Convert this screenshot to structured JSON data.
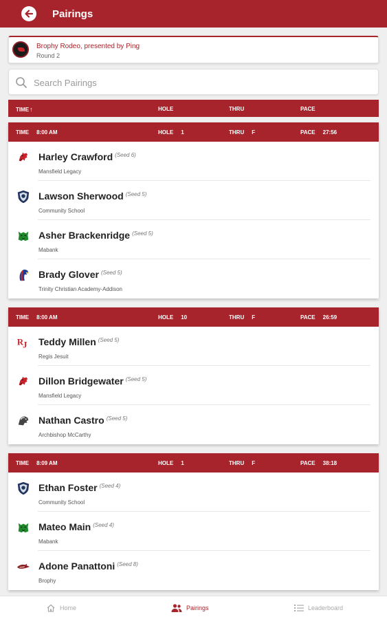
{
  "appbar": {
    "title": "Pairings"
  },
  "event": {
    "name": "Brophy Rodeo, presented by Ping",
    "round": "Round 2"
  },
  "search": {
    "placeholder": "Search Pairings"
  },
  "table_header": {
    "time": "TIME",
    "sort_indicator": "↑",
    "hole": "HOLE",
    "thru": "THRU",
    "pace": "PACE"
  },
  "groups": [
    {
      "labels": {
        "time": "TIME",
        "hole": "HOLE",
        "thru": "THRU",
        "pace": "PACE"
      },
      "time": "8:00 AM",
      "hole": "1",
      "thru": "F",
      "pace": "27:56",
      "players": [
        {
          "name": "Harley Crawford",
          "seed": "(Seed 6)",
          "school": "Mansfield Legacy",
          "icon": "bronco-logo-icon"
        },
        {
          "name": "Lawson Sherwood",
          "seed": "(Seed 5)",
          "school": "Community School",
          "icon": "shield-logo-icon"
        },
        {
          "name": "Asher Brackenridge",
          "seed": "(Seed 5)",
          "school": "Mabank",
          "icon": "panther-logo-icon"
        },
        {
          "name": "Brady Glover",
          "seed": "(Seed 5)",
          "school": "Trinity Christian Academy-Addison",
          "icon": "eagle-logo-icon"
        }
      ]
    },
    {
      "labels": {
        "time": "TIME",
        "hole": "HOLE",
        "thru": "THRU",
        "pace": "PACE"
      },
      "time": "8:00 AM",
      "hole": "10",
      "thru": "F",
      "pace": "26:59",
      "players": [
        {
          "name": "Teddy Millen",
          "seed": "(Seed 5)",
          "school": "Regis Jesuit",
          "icon": "rj-logo-icon"
        },
        {
          "name": "Dillon Bridgewater",
          "seed": "(Seed 5)",
          "school": "Mansfield Legacy",
          "icon": "bronco-logo-icon"
        },
        {
          "name": "Nathan Castro",
          "seed": "(Seed 5)",
          "school": "Archbishop McCarthy",
          "icon": "mustang-logo-icon"
        }
      ]
    },
    {
      "labels": {
        "time": "TIME",
        "hole": "HOLE",
        "thru": "THRU",
        "pace": "PACE"
      },
      "time": "8:09 AM",
      "hole": "1",
      "thru": "F",
      "pace": "38:18",
      "players": [
        {
          "name": "Ethan Foster",
          "seed": "(Seed 4)",
          "school": "Community School",
          "icon": "shield-logo-icon"
        },
        {
          "name": "Mateo Main",
          "seed": "(Seed 4)",
          "school": "Mabank",
          "icon": "panther-logo-icon"
        },
        {
          "name": "Adone Panattoni",
          "seed": "(Seed 8)",
          "school": "Brophy",
          "icon": "bronco-head-logo-icon"
        }
      ]
    }
  ],
  "nav": {
    "home": "Home",
    "pairings": "Pairings",
    "leaderboard": "Leaderboard"
  },
  "colors": {
    "primary": "#a8242c",
    "background": "#efefef",
    "muted": "#aaaaaa"
  }
}
